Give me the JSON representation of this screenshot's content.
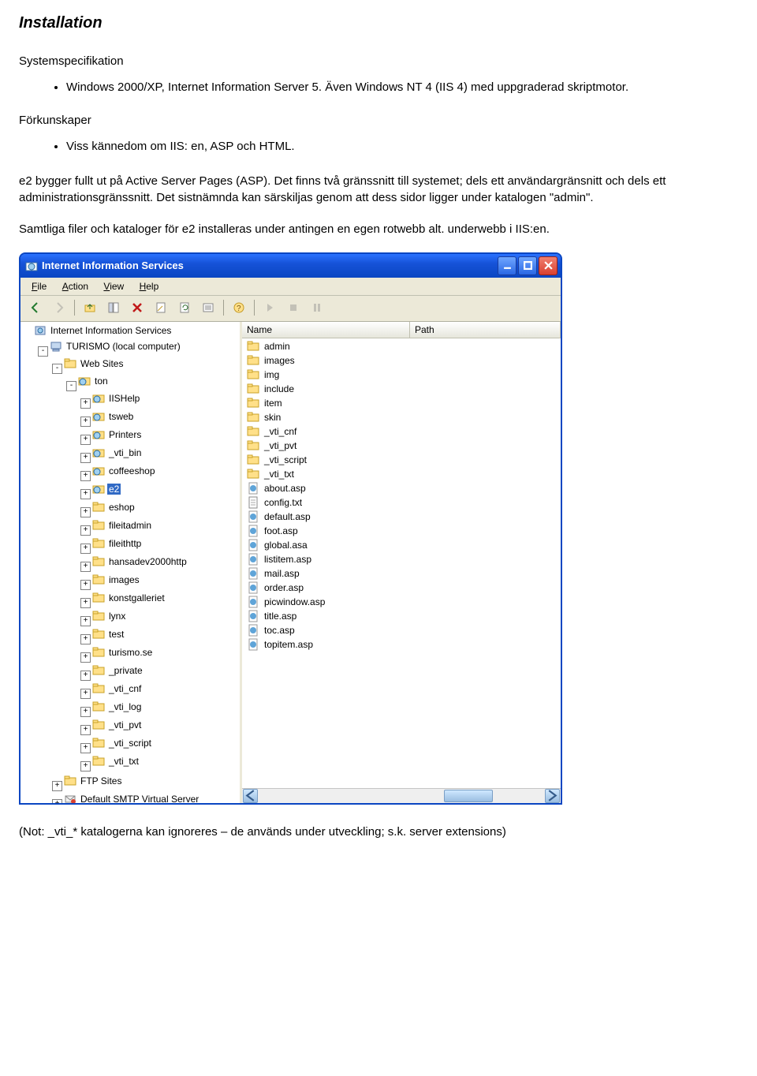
{
  "doc": {
    "title": "Installation",
    "sysspec_label": "Systemspecifikation",
    "sysspec_bullet": "Windows 2000/XP, Internet Information Server 5. Även Windows NT 4 (IIS 4) med uppgraderad skriptmotor.",
    "forkunskaper_label": "Förkunskaper",
    "forkunskaper_bullet": "Viss kännedom om IIS: en, ASP och HTML.",
    "para1": "e2 bygger fullt ut på Active Server Pages (ASP). Det finns två gränssnitt till systemet; dels ett användargränsnitt och dels ett administrationsgränssnitt. Det sistnämnda kan särskiljas genom att dess sidor ligger under katalogen \"admin\".",
    "para2": "Samtliga filer och kataloger för e2 installeras under antingen en egen rotwebb alt. underwebb i IIS:en.",
    "footnote": "(Not: _vti_* katalogerna kan ignoreres – de används under utveckling; s.k. server extensions)"
  },
  "window": {
    "title": "Internet Information Services",
    "menus": [
      "File",
      "Action",
      "View",
      "Help"
    ],
    "columns": {
      "name": "Name",
      "path": "Path"
    },
    "tree": {
      "root": "Internet Information Services",
      "computer": "TURISMO (local computer)",
      "websites": "Web Sites",
      "site": "ton",
      "children": [
        {
          "label": "IISHelp",
          "icon": "globe"
        },
        {
          "label": "tsweb",
          "icon": "globe"
        },
        {
          "label": "Printers",
          "icon": "globe"
        },
        {
          "label": "_vti_bin",
          "icon": "globe"
        },
        {
          "label": "coffeeshop",
          "icon": "globe"
        },
        {
          "label": "e2",
          "icon": "globe",
          "selected": true
        },
        {
          "label": "eshop",
          "icon": "folder"
        },
        {
          "label": "fileitadmin",
          "icon": "folder"
        },
        {
          "label": "fileithttp",
          "icon": "folder"
        },
        {
          "label": "hansadev2000http",
          "icon": "folder"
        },
        {
          "label": "images",
          "icon": "folder"
        },
        {
          "label": "konstgalleriet",
          "icon": "folder"
        },
        {
          "label": "lynx",
          "icon": "folder"
        },
        {
          "label": "test",
          "icon": "folder"
        },
        {
          "label": "turismo.se",
          "icon": "folder"
        },
        {
          "label": "_private",
          "icon": "folder"
        },
        {
          "label": "_vti_cnf",
          "icon": "folder"
        },
        {
          "label": "_vti_log",
          "icon": "folder"
        },
        {
          "label": "_vti_pvt",
          "icon": "folder"
        },
        {
          "label": "_vti_script",
          "icon": "folder"
        },
        {
          "label": "_vti_txt",
          "icon": "folder"
        }
      ],
      "ftp": "FTP Sites",
      "smtp": "Default SMTP Virtual Server"
    },
    "files": [
      {
        "name": "admin",
        "icon": "folder"
      },
      {
        "name": "images",
        "icon": "folder"
      },
      {
        "name": "img",
        "icon": "folder"
      },
      {
        "name": "include",
        "icon": "folder"
      },
      {
        "name": "item",
        "icon": "folder"
      },
      {
        "name": "skin",
        "icon": "folder"
      },
      {
        "name": "_vti_cnf",
        "icon": "folder"
      },
      {
        "name": "_vti_pvt",
        "icon": "folder"
      },
      {
        "name": "_vti_script",
        "icon": "folder"
      },
      {
        "name": "_vti_txt",
        "icon": "folder"
      },
      {
        "name": "about.asp",
        "icon": "asp"
      },
      {
        "name": "config.txt",
        "icon": "file"
      },
      {
        "name": "default.asp",
        "icon": "asp"
      },
      {
        "name": "foot.asp",
        "icon": "asp"
      },
      {
        "name": "global.asa",
        "icon": "asp"
      },
      {
        "name": "listitem.asp",
        "icon": "asp"
      },
      {
        "name": "mail.asp",
        "icon": "asp"
      },
      {
        "name": "order.asp",
        "icon": "asp"
      },
      {
        "name": "picwindow.asp",
        "icon": "asp"
      },
      {
        "name": "title.asp",
        "icon": "asp"
      },
      {
        "name": "toc.asp",
        "icon": "asp"
      },
      {
        "name": "topitem.asp",
        "icon": "asp"
      }
    ]
  }
}
